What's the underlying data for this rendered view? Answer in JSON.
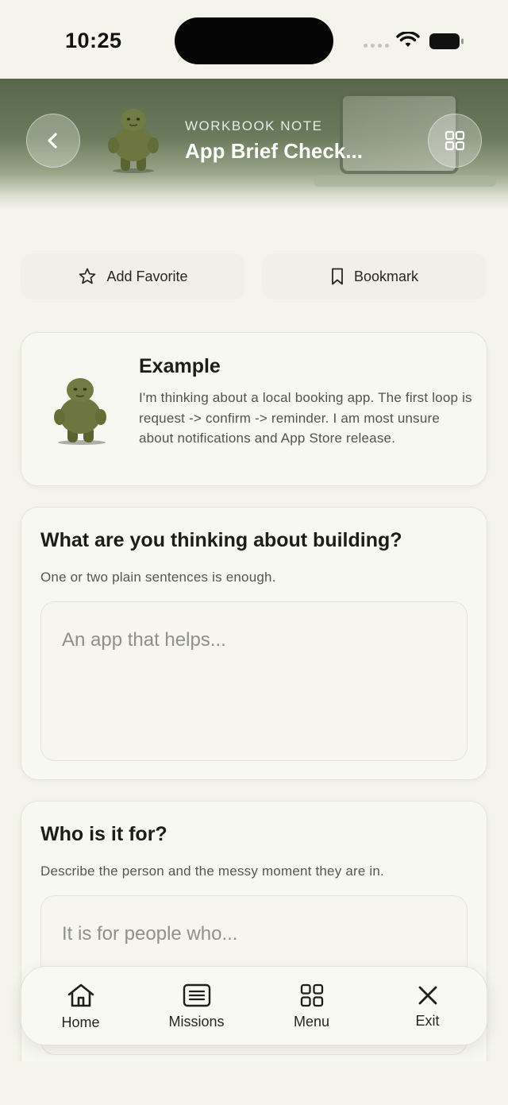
{
  "status_bar": {
    "time": "10:25"
  },
  "header": {
    "overline": "WORKBOOK NOTE",
    "title": "App Brief Check..."
  },
  "actions": {
    "favorite_label": "Add Favorite",
    "bookmark_label": "Bookmark"
  },
  "example": {
    "title": "Example",
    "body": "I'm thinking about a local booking app. The first loop is request -> confirm -> reminder. I am most unsure about notifications and App Store release."
  },
  "questions": [
    {
      "title": "What are you thinking about building?",
      "subtitle": "One or two plain sentences is enough.",
      "placeholder": "An app that helps..."
    },
    {
      "title": "Who is it for?",
      "subtitle": "Describe the person and the messy moment they are in.",
      "placeholder": "It is for people who..."
    }
  ],
  "nav": [
    {
      "label": "Home",
      "icon": "home-icon"
    },
    {
      "label": "Missions",
      "icon": "list-icon"
    },
    {
      "label": "Menu",
      "icon": "grid-icon"
    },
    {
      "label": "Exit",
      "icon": "close-icon"
    }
  ],
  "colors": {
    "background": "#f4f3ec",
    "header_green": "#5f6c52",
    "card": "#f8f8f2",
    "text": "#1e1f1c"
  }
}
